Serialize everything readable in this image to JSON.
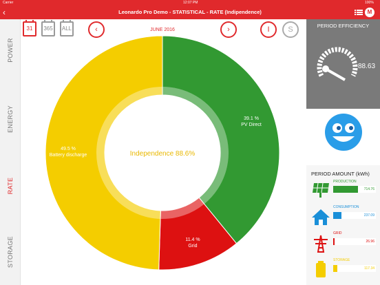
{
  "status": {
    "carrier": "Carrier",
    "time": "12:07 PM",
    "battery": "100%"
  },
  "header": {
    "title": "Leonardo Pro Demo - STATISTICAL - RATE (Indipendence)",
    "back_icon": "chevron-left-icon",
    "menu_icon": "list-icon",
    "logo_text": "M"
  },
  "sidebar": {
    "items": [
      {
        "label": "POWER"
      },
      {
        "label": "ENERGY"
      },
      {
        "label": "RATE"
      },
      {
        "label": "STORAGE"
      }
    ],
    "active": "RATE"
  },
  "toolbar": {
    "periods": [
      {
        "label": "31"
      },
      {
        "label": "365"
      },
      {
        "label": "ALL"
      }
    ],
    "prev_label": "‹",
    "next_label": "›",
    "month": "JUNE 2016",
    "toggle_i": "I",
    "toggle_s": "S"
  },
  "chart_data": {
    "type": "pie",
    "center_label": "Independence 88.6%",
    "slices": [
      {
        "label": "PV Direct",
        "value": 39.1,
        "value_text": "39.1 %",
        "color": "#329932"
      },
      {
        "label": "Grid",
        "value": 11.4,
        "value_text": "11.4 %",
        "color": "#dd1111"
      },
      {
        "label": "Battery discharge",
        "value": 49.5,
        "value_text": "49.5 %",
        "color": "#f4cd00"
      }
    ]
  },
  "efficiency": {
    "title": "PERIOD EFFICIENCY",
    "value": "88.63"
  },
  "amounts": {
    "title": "PERIOD AMOUNT (kWh)",
    "rows": [
      {
        "label": "PRODUCTION",
        "value": "714.76",
        "color": "#329932",
        "fill": 0.58
      },
      {
        "label": "CONSUMPTION",
        "value": "237.09",
        "color": "#1a8fd8",
        "fill": 0.19
      },
      {
        "label": "GRID",
        "value": "26.96",
        "color": "#dd1111",
        "fill": 0.03
      },
      {
        "label": "STORAGE",
        "value": "117.34",
        "color": "#f4cd00",
        "fill": 0.1
      }
    ]
  },
  "colors": {
    "brand": "#e0292c"
  }
}
